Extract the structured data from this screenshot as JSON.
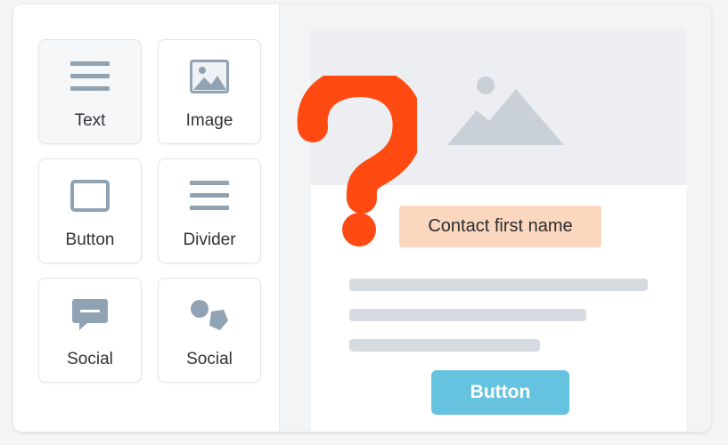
{
  "sidebar": {
    "blocks": [
      {
        "label": "Text",
        "icon": "text-lines-icon"
      },
      {
        "label": "Image",
        "icon": "image-icon"
      },
      {
        "label": "Button",
        "icon": "button-rectangle-icon"
      },
      {
        "label": "Divider",
        "icon": "divider-lines-icon"
      },
      {
        "label": "Social",
        "icon": "chat-bubble-icon"
      },
      {
        "label": "Social",
        "icon": "social-shapes-icon"
      }
    ]
  },
  "email": {
    "merge_tag": "Contact first name",
    "button_label": "Button"
  },
  "colors": {
    "icon": "#8fa3b3",
    "merge_tag_bg": "#fbd7bf",
    "cta_bg": "#66c3e0",
    "question_mark": "#ff4a12",
    "hero_bg": "#eceef2"
  }
}
